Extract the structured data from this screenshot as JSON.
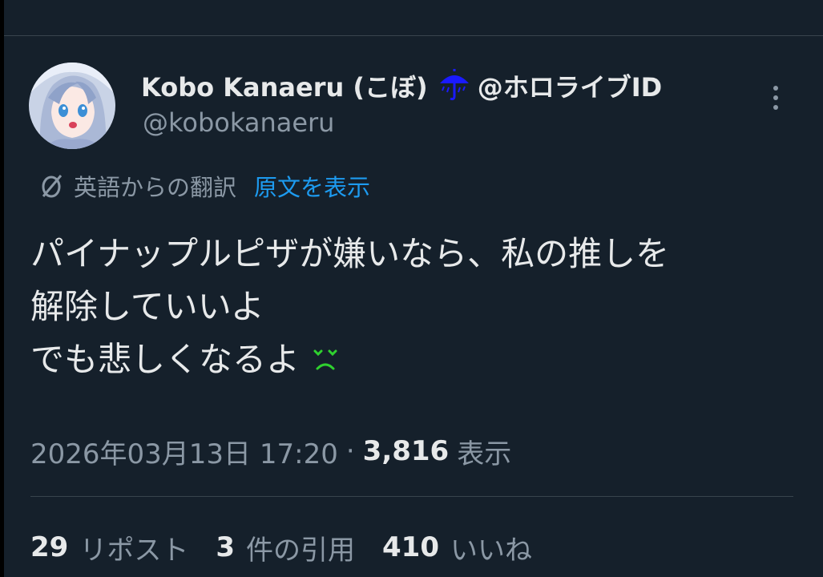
{
  "colors": {
    "background": "#15202b",
    "primary_text": "#e7e9ea",
    "secondary_text": "#8b98a5",
    "link": "#1d9bf0",
    "divider": "#38444d",
    "umbrella": "#1a1aff",
    "emoji": "#2fd12f"
  },
  "author": {
    "name": "Kobo Kanaeru (こぼ)",
    "name_suffix": "@ホロライブID",
    "badge_icon": "umbrella-icon",
    "handle": "@kobokanaeru"
  },
  "translation": {
    "label": "英語からの翻訳",
    "show_original": "原文を表示",
    "icon": "translate-icon"
  },
  "tweet": {
    "lines": [
      "パイナップルピザが嫌いなら、私の推しを",
      "解除していいよ",
      "でも悲しくなるよ"
    ],
    "emoji": "sad-face-emoji"
  },
  "meta": {
    "timestamp": "2026年03月13日 17:20",
    "separator": "·",
    "views_count": "3,816",
    "views_label": "表示"
  },
  "stats": {
    "reposts": {
      "count": "29",
      "label": "リポスト"
    },
    "quotes": {
      "count": "3",
      "label": "件の引用"
    },
    "likes": {
      "count": "410",
      "label": "いいね"
    }
  }
}
